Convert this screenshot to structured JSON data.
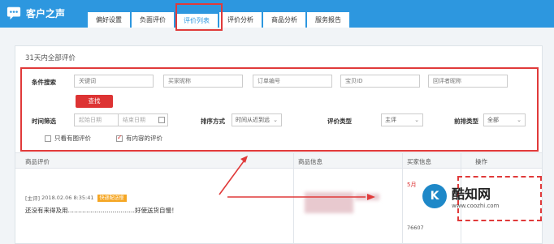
{
  "brand": {
    "title": "客户之声"
  },
  "tabs": [
    {
      "label": "偏好设置"
    },
    {
      "label": "负面评价"
    },
    {
      "label": "评价列表"
    },
    {
      "label": "评价分析"
    },
    {
      "label": "商品分析"
    },
    {
      "label": "服务报告"
    }
  ],
  "panel": {
    "title": "31天内全部评价"
  },
  "filters": {
    "condition_label": "条件搜索",
    "keyword_placeholder": "关键词",
    "buyer_placeholder": "买家昵称",
    "order_placeholder": "订单编号",
    "item_placeholder": "宝贝ID",
    "reviewer_placeholder": "回评者昵称",
    "search_button": "查找",
    "time_label": "时间筛选",
    "start_placeholder": "起始日期",
    "end_placeholder": "结束日期",
    "sort_label": "排序方式",
    "sort_value": "时间从近到远",
    "type_label": "评价类型",
    "type_value": "主评",
    "reply_label": "前排类型",
    "reply_value": "全部",
    "only_images": "只看有图评价",
    "has_content": "有内容的评价"
  },
  "table": {
    "columns": [
      "商品评价",
      "商品信息",
      "买家信息",
      "操作"
    ],
    "row": {
      "tag": "[主评]",
      "time": "2018.02.06 8:35:41",
      "badge": "快递配送慢",
      "comment": "还没有来得及用……………………………好使送货自慢！",
      "buyer_partial": "5月",
      "buyer_num": "76607"
    }
  },
  "watermark": {
    "logo": "K",
    "title": "酷知网",
    "url": "www.coozhi.com"
  }
}
